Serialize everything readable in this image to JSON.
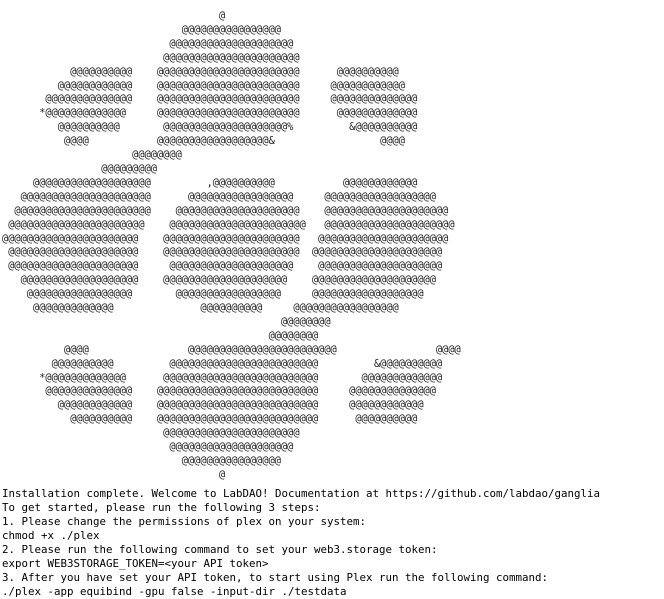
{
  "terminal": {
    "ascii_logo": "                                   @\n                             @@@@@@@@@@@@@@@@\n                           @@@@@@@@@@@@@@@@@@@@\n                          @@@@@@@@@@@@@@@@@@@@@@\n           @@@@@@@@@@    @@@@@@@@@@@@@@@@@@@@@@@      @@@@@@@@@@\n         @@@@@@@@@@@@    @@@@@@@@@@@@@@@@@@@@@@@     @@@@@@@@@@@@\n       @@@@@@@@@@@@@@    @@@@@@@@@@@@@@@@@@@@@@@     @@@@@@@@@@@@@@\n      *@@@@@@@@@@@@@     @@@@@@@@@@@@@@@@@@@@@@@      @@@@@@@@@@@@@\n         @@@@@@@@@@       @@@@@@@@@@@@@@@@@@@@%         &@@@@@@@@@@\n          @@@@           @@@@@@@@@@@@@@@@@@&                 @@@@\n                     @@@@@@@@\n                @@@@@@@@@\n     @@@@@@@@@@@@@@@@@@@         ,@@@@@@@@@@           @@@@@@@@@@@@\n   @@@@@@@@@@@@@@@@@@@@@      @@@@@@@@@@@@@@@@@     @@@@@@@@@@@@@@@@@@\n  @@@@@@@@@@@@@@@@@@@@@@    @@@@@@@@@@@@@@@@@@@@    @@@@@@@@@@@@@@@@@@@@\n @@@@@@@@@@@@@@@@@@@@@@    @@@@@@@@@@@@@@@@@@@@@@   @@@@@@@@@@@@@@@@@@@@@\n@@@@@@@@@@@@@@@@@@@@@@    @@@@@@@@@@@@@@@@@@@@@@   @@@@@@@@@@@@@@@@@@@@@\n @@@@@@@@@@@@@@@@@@@@@    @@@@@@@@@@@@@@@@@@@@@@  @@@@@@@@@@@@@@@@@@@@@\n @@@@@@@@@@@@@@@@@@@@@     @@@@@@@@@@@@@@@@@@@@    @@@@@@@@@@@@@@@@@@@@\n   @@@@@@@@@@@@@@@@@@@    @@@@@@@@@@@@@@@@@@@@    @@@@@@@@@@@@@@@@@@@@\n    @@@@@@@@@@@@@@@@@       @@@@@@@@@@@@@@@@@     @@@@@@@@@@@@@@@@@@\n     @@@@@@@@@@@@@              @@@@@@@@@@     @@@@@@@@@@@@@@@@@\n                                             @@@@@@@@\n                                           @@@@@@@@\n          @@@@                @@@@@@@@@@@@@@@@@@@@@@@@                @@@@\n        @@@@@@@@@@         @@@@@@@@@@@@@@@@@@@@@@@@         &@@@@@@@@@@\n      *@@@@@@@@@@@@@      @@@@@@@@@@@@@@@@@@@@@@@@@       @@@@@@@@@@@@@\n       @@@@@@@@@@@@@@    @@@@@@@@@@@@@@@@@@@@@@@@@@     @@@@@@@@@@@@@@\n         @@@@@@@@@@@@    @@@@@@@@@@@@@@@@@@@@@@@@@@     @@@@@@@@@@@@\n           @@@@@@@@@@    @@@@@@@@@@@@@@@@@@@@@@@@@@      @@@@@@@@@@\n                          @@@@@@@@@@@@@@@@@@@@@@\n                           @@@@@@@@@@@@@@@@@@@@\n                             @@@@@@@@@@@@@@@@\n                                   @",
    "lines": [
      "Installation complete. Welcome to LabDAO! Documentation at https://github.com/labdao/ganglia",
      "To get started, please run the following 3 steps:",
      "1. Please change the permissions of plex on your system:",
      "chmod +x ./plex",
      "2. Please run the following command to set your web3.storage token:",
      "export WEB3STORAGE_TOKEN=<your API token>",
      "3. After you have set your API token, to start using Plex run the following command:",
      "./plex -app equibind -gpu false -input-dir ./testdata"
    ]
  }
}
